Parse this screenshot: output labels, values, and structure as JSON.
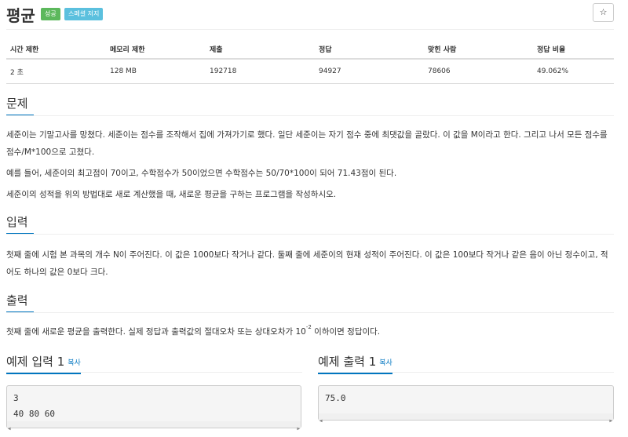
{
  "problem": {
    "title": "평균",
    "badges": [
      "성공",
      "스페셜 저지"
    ],
    "star_icon": "☆"
  },
  "info_table": {
    "headers": [
      "시간 제한",
      "메모리 제한",
      "제출",
      "정답",
      "맞힌 사람",
      "정답 비율"
    ],
    "values": [
      "2 초",
      "128 MB",
      "192718",
      "94927",
      "78606",
      "49.062%"
    ]
  },
  "sections": {
    "problem": {
      "title": "문제",
      "paragraphs": [
        "세준이는 기말고사를 망쳤다. 세준이는 점수를 조작해서 집에 가져가기로 했다. 일단 세준이는 자기 점수 중에 최댓값을 골랐다. 이 값을 M이라고 한다. 그리고 나서 모든 점수를 점수/M*100으로 고쳤다.",
        "예를 들어, 세준이의 최고점이 70이고, 수학점수가 50이었으면 수학점수는 50/70*100이 되어 71.43점이 된다.",
        "세준이의 성적을 위의 방법대로 새로 계산했을 때, 새로운 평균을 구하는 프로그램을 작성하시오."
      ]
    },
    "input": {
      "title": "입력",
      "text": "첫째 줄에 시험 본 과목의 개수 N이 주어진다. 이 값은 1000보다 작거나 같다. 둘째 줄에 세준이의 현재 성적이 주어진다. 이 값은 100보다 작거나 같은 음이 아닌 정수이고, 적어도 하나의 값은 0보다 크다."
    },
    "output": {
      "title": "출력",
      "text_before": "첫째 줄에 새로운 평균을 출력한다. 실제 정답과 출력값의 절대오차 또는 상대오차가 10",
      "sup": "-2",
      "text_after": " 이하이면 정답이다."
    }
  },
  "samples": {
    "input": {
      "title": "예제 입력 1",
      "copy": "복사",
      "lines": [
        "3",
        "40 80 60"
      ]
    },
    "output": {
      "title": "예제 출력 1",
      "copy": "복사",
      "lines": [
        "75.0"
      ]
    }
  },
  "colors": {
    "accent": "#0076c0",
    "badge_success": "#5cb85c",
    "badge_special": "#5bc0de"
  }
}
